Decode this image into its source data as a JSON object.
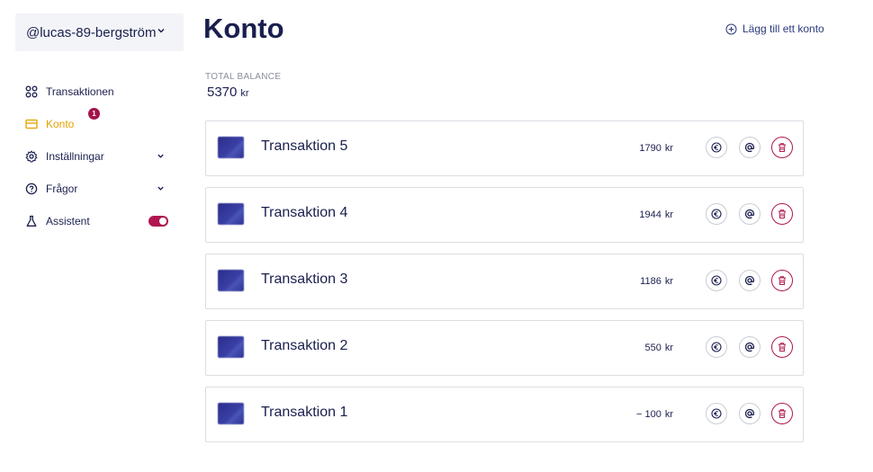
{
  "user": {
    "name": "@lucas-89-bergström"
  },
  "nav": {
    "items": [
      {
        "label": "Transaktionen",
        "icon": "grid-icon"
      },
      {
        "label": "Konto",
        "icon": "card-icon",
        "badge": "1",
        "active": true
      },
      {
        "label": "Inställningar",
        "icon": "gear-icon",
        "expandable": true
      },
      {
        "label": "Frågor",
        "icon": "question-icon",
        "expandable": true
      },
      {
        "label": "Assistent",
        "icon": "flask-icon",
        "toggle": true
      }
    ]
  },
  "page": {
    "title": "Konto",
    "add_account_label": "Lägg till ett konto",
    "balance_label": "TOTAL BALANCE",
    "balance_value": "5370",
    "balance_currency": "kr"
  },
  "transactions": [
    {
      "name": "Transaktion 5",
      "amount": "1790",
      "currency": "kr"
    },
    {
      "name": "Transaktion 4",
      "amount": "1944",
      "currency": "kr"
    },
    {
      "name": "Transaktion 3",
      "amount": "1186",
      "currency": "kr"
    },
    {
      "name": "Transaktion 2",
      "amount": "550",
      "currency": "kr"
    },
    {
      "name": "Transaktion 1",
      "amount": "− 100",
      "currency": "kr"
    }
  ],
  "colors": {
    "primary_text": "#1a1f4e",
    "active_nav": "#e5a100",
    "accent": "#b0164f",
    "card_border": "#dcdee4"
  }
}
